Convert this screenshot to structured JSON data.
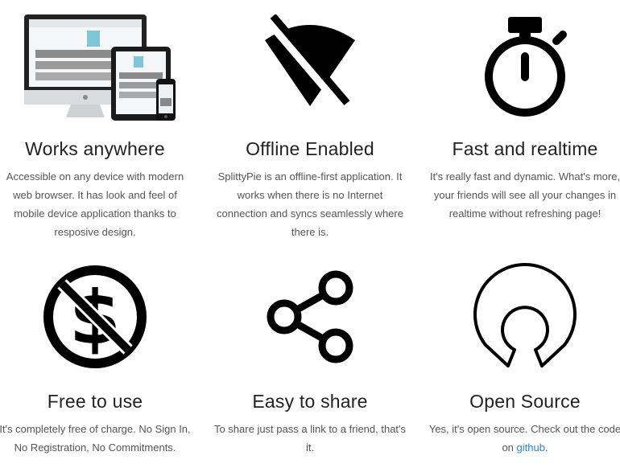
{
  "features": [
    {
      "title": "Works anywhere",
      "description": "Accessible on any device with modern web browser. It has look and feel of mobile device application thanks to resposive design.",
      "icon": "devices-icon"
    },
    {
      "title": "Offline Enabled",
      "description": "SplittyPie is an offline-first application. It works when there is no Internet connection and syncs seamlessly where there is.",
      "icon": "wifi-off-icon"
    },
    {
      "title": "Fast and realtime",
      "description": "It's really fast and dynamic. What's more, your friends will see all your changes in realtime without refreshing page!",
      "icon": "stopwatch-icon"
    },
    {
      "title": "Free to use",
      "description": "It's completely free of charge. No Sign In, No Registration, No Commitments.",
      "icon": "no-money-icon"
    },
    {
      "title": "Easy to share",
      "description": "To share just pass a link to a friend, that's it.",
      "icon": "share-icon"
    },
    {
      "title": "Open Source",
      "description_before": "Yes, it's open source. Check out the code on ",
      "link_text": "github",
      "description_after": ".",
      "icon": "open-source-icon"
    }
  ],
  "colors": {
    "icon": "#000000",
    "link": "#2a86c7",
    "text": "#555555",
    "title": "#222222"
  }
}
